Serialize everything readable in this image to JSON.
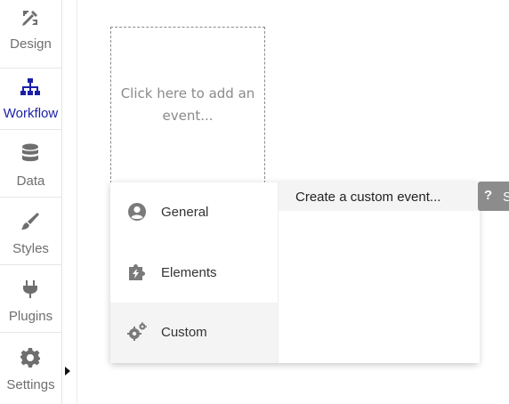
{
  "sidebar": {
    "items": [
      {
        "label": "Design",
        "icon": "design-icon"
      },
      {
        "label": "Workflow",
        "icon": "workflow-icon",
        "active": true
      },
      {
        "label": "Data",
        "icon": "database-icon"
      },
      {
        "label": "Styles",
        "icon": "brush-icon"
      },
      {
        "label": "Plugins",
        "icon": "plug-icon"
      },
      {
        "label": "Settings",
        "icon": "gear-icon"
      }
    ],
    "active_color": "#1b1fa8"
  },
  "canvas": {
    "event_placeholder": "Click here to add an event..."
  },
  "event_menu": {
    "categories": [
      {
        "label": "General",
        "icon": "user-circle-icon"
      },
      {
        "label": "Elements",
        "icon": "puzzle-lightning-icon"
      },
      {
        "label": "Custom",
        "icon": "gears-icon",
        "selected": true
      }
    ],
    "submenu": [
      {
        "label": "Create a custom event..."
      }
    ]
  },
  "help_tab": {
    "glyph": "?",
    "label": "S"
  }
}
